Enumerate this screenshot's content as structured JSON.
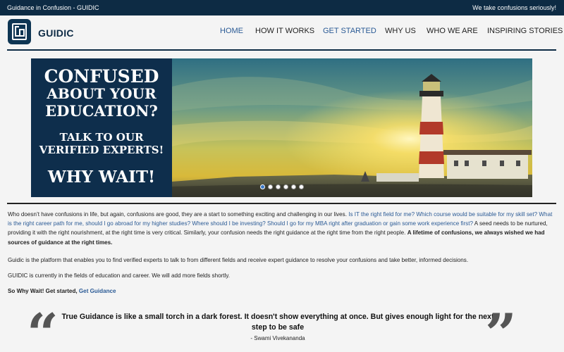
{
  "topbar": {
    "title": "Guidance in Confusion - GUIDIC",
    "tagline": "We take confusions seriously!"
  },
  "brand": {
    "name": "GUIDIC"
  },
  "nav": {
    "items": [
      {
        "label": "HOME"
      },
      {
        "label": "HOW IT WORKS"
      },
      {
        "label": "GET STARTED"
      },
      {
        "label": "WHY US"
      },
      {
        "label": "WHO WE ARE"
      },
      {
        "label": "INSPIRING STORIES"
      }
    ]
  },
  "banner": {
    "line1": "CONFUSED",
    "line2": "ABOUT YOUR",
    "line3": "EDUCATION?",
    "line4": "TALK TO OUR",
    "line5": "VERIFIED EXPERTS!",
    "line6": "WHY WAIT!",
    "active_slide": 1,
    "slide_count": 6
  },
  "content": {
    "p1_a": "Who doesn’t have confusions in life, but again, confusions are good, they are a start to something exciting and challenging in our lives. ",
    "p1_link": "Is IT the right field for me? Which course would be suitable for my skill set? What is the right career path for me, should I go abroad for my higher studies? Where should I be investing? Should I go for my MBA right after graduation or gain some work experience first?",
    "p1_b": " A seed needs to be nurtured, providing it with the right nourishment, at the right time is very critical. Similarly, your confusion needs the right guidance at the right time from the right people. ",
    "p1_bold": "A lifetime of confusions, we always wished we had sources of guidance at the right times.",
    "p2": "Guidic is the platform that enables you to find verified experts to talk to from different fields and receive expert guidance to resolve your confusions and take better, informed decisions.",
    "p3": "GUIDIC is currently in the fields of education and career. We will add more fields shortly.",
    "p4_text": "So Why Wait! Get started, ",
    "p4_link": "Get Guidance"
  },
  "quote": {
    "text": "True Guidance is like a small torch in a dark forest. It doesn't show everything at once. But gives enough light for the next step to be safe",
    "author": "- Swami Vivekananda"
  },
  "colors": {
    "topbar": "#0d2b44",
    "accent": "#2a5a95",
    "banner_panel": "#0e2e4c"
  }
}
